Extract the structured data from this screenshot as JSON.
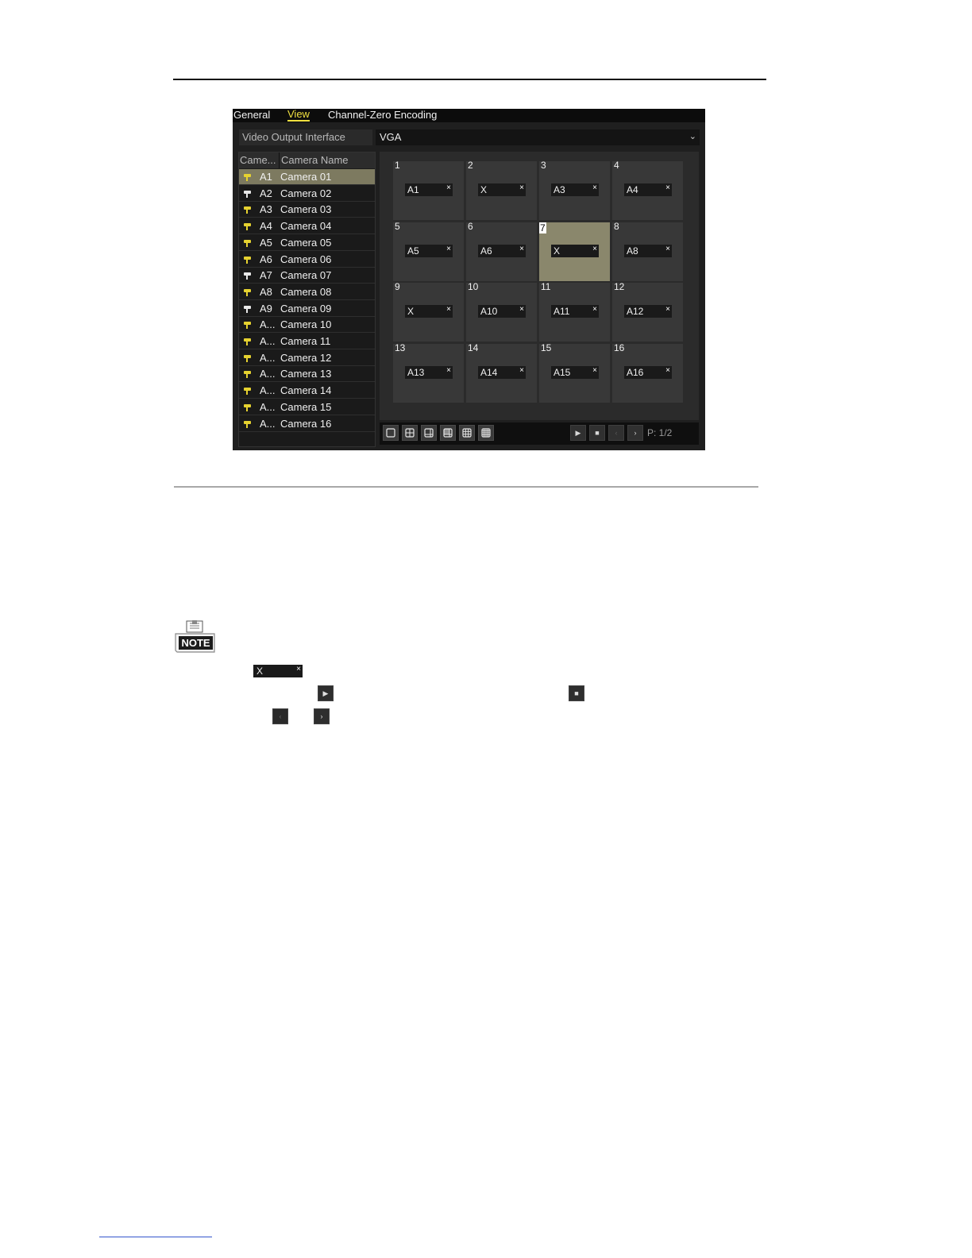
{
  "tabs": [
    {
      "label": "General"
    },
    {
      "label": "View"
    },
    {
      "label": "Channel-Zero Encoding"
    }
  ],
  "video_output": {
    "label": "Video Output Interface",
    "value": "VGA"
  },
  "camera_list": {
    "headers": {
      "id": "Came...",
      "name": "Camera Name"
    },
    "rows": [
      {
        "id": "A1",
        "name": "Camera 01",
        "icon_color": "#e6d230"
      },
      {
        "id": "A2",
        "name": "Camera 02",
        "icon_color": "#e8e8e8"
      },
      {
        "id": "A3",
        "name": "Camera 03",
        "icon_color": "#e6d230"
      },
      {
        "id": "A4",
        "name": "Camera 04",
        "icon_color": "#e6d230"
      },
      {
        "id": "A5",
        "name": "Camera 05",
        "icon_color": "#e6d230"
      },
      {
        "id": "A6",
        "name": "Camera 06",
        "icon_color": "#e6d230"
      },
      {
        "id": "A7",
        "name": "Camera 07",
        "icon_color": "#e8e8e8"
      },
      {
        "id": "A8",
        "name": "Camera 08",
        "icon_color": "#e6d230"
      },
      {
        "id": "A9",
        "name": "Camera 09",
        "icon_color": "#e8e8e8"
      },
      {
        "id": "A...",
        "name": "Camera 10",
        "icon_color": "#e6d230"
      },
      {
        "id": "A...",
        "name": "Camera 11",
        "icon_color": "#e6d230"
      },
      {
        "id": "A...",
        "name": "Camera 12",
        "icon_color": "#e6d230"
      },
      {
        "id": "A...",
        "name": "Camera 13",
        "icon_color": "#e6d230"
      },
      {
        "id": "A...",
        "name": "Camera 14",
        "icon_color": "#e6d230"
      },
      {
        "id": "A...",
        "name": "Camera 15",
        "icon_color": "#e6d230"
      },
      {
        "id": "A...",
        "name": "Camera 16",
        "icon_color": "#e6d230"
      }
    ]
  },
  "grid": {
    "cells": [
      {
        "num": "1",
        "label": "A1"
      },
      {
        "num": "2",
        "label": "X"
      },
      {
        "num": "3",
        "label": "A3"
      },
      {
        "num": "4",
        "label": "A4"
      },
      {
        "num": "5",
        "label": "A5"
      },
      {
        "num": "6",
        "label": "A6"
      },
      {
        "num": "7",
        "label": "X"
      },
      {
        "num": "8",
        "label": "A8"
      },
      {
        "num": "9",
        "label": "X"
      },
      {
        "num": "10",
        "label": "A10"
      },
      {
        "num": "11",
        "label": "A11"
      },
      {
        "num": "12",
        "label": "A12"
      },
      {
        "num": "13",
        "label": "A13"
      },
      {
        "num": "14",
        "label": "A14"
      },
      {
        "num": "15",
        "label": "A15"
      },
      {
        "num": "16",
        "label": "A16"
      }
    ],
    "remove_glyph": "×"
  },
  "toolbar": {
    "layout_icons": [
      "layout-1-icon",
      "layout-4-icon",
      "layout-6-icon",
      "layout-8-icon",
      "layout-9-icon",
      "layout-16-icon"
    ],
    "play_glyph": "▶",
    "stop_glyph": "■",
    "prev_glyph": "‹",
    "next_glyph": "›",
    "page_indicator": "P: 1/2"
  },
  "note": {
    "icon_text": "NOTE",
    "inline_label": "X",
    "inline_remove": "×"
  },
  "colors": {
    "active_tab": "#f0e040",
    "selected_row": "#7d7a60",
    "selected_cell": "#8a876c"
  }
}
